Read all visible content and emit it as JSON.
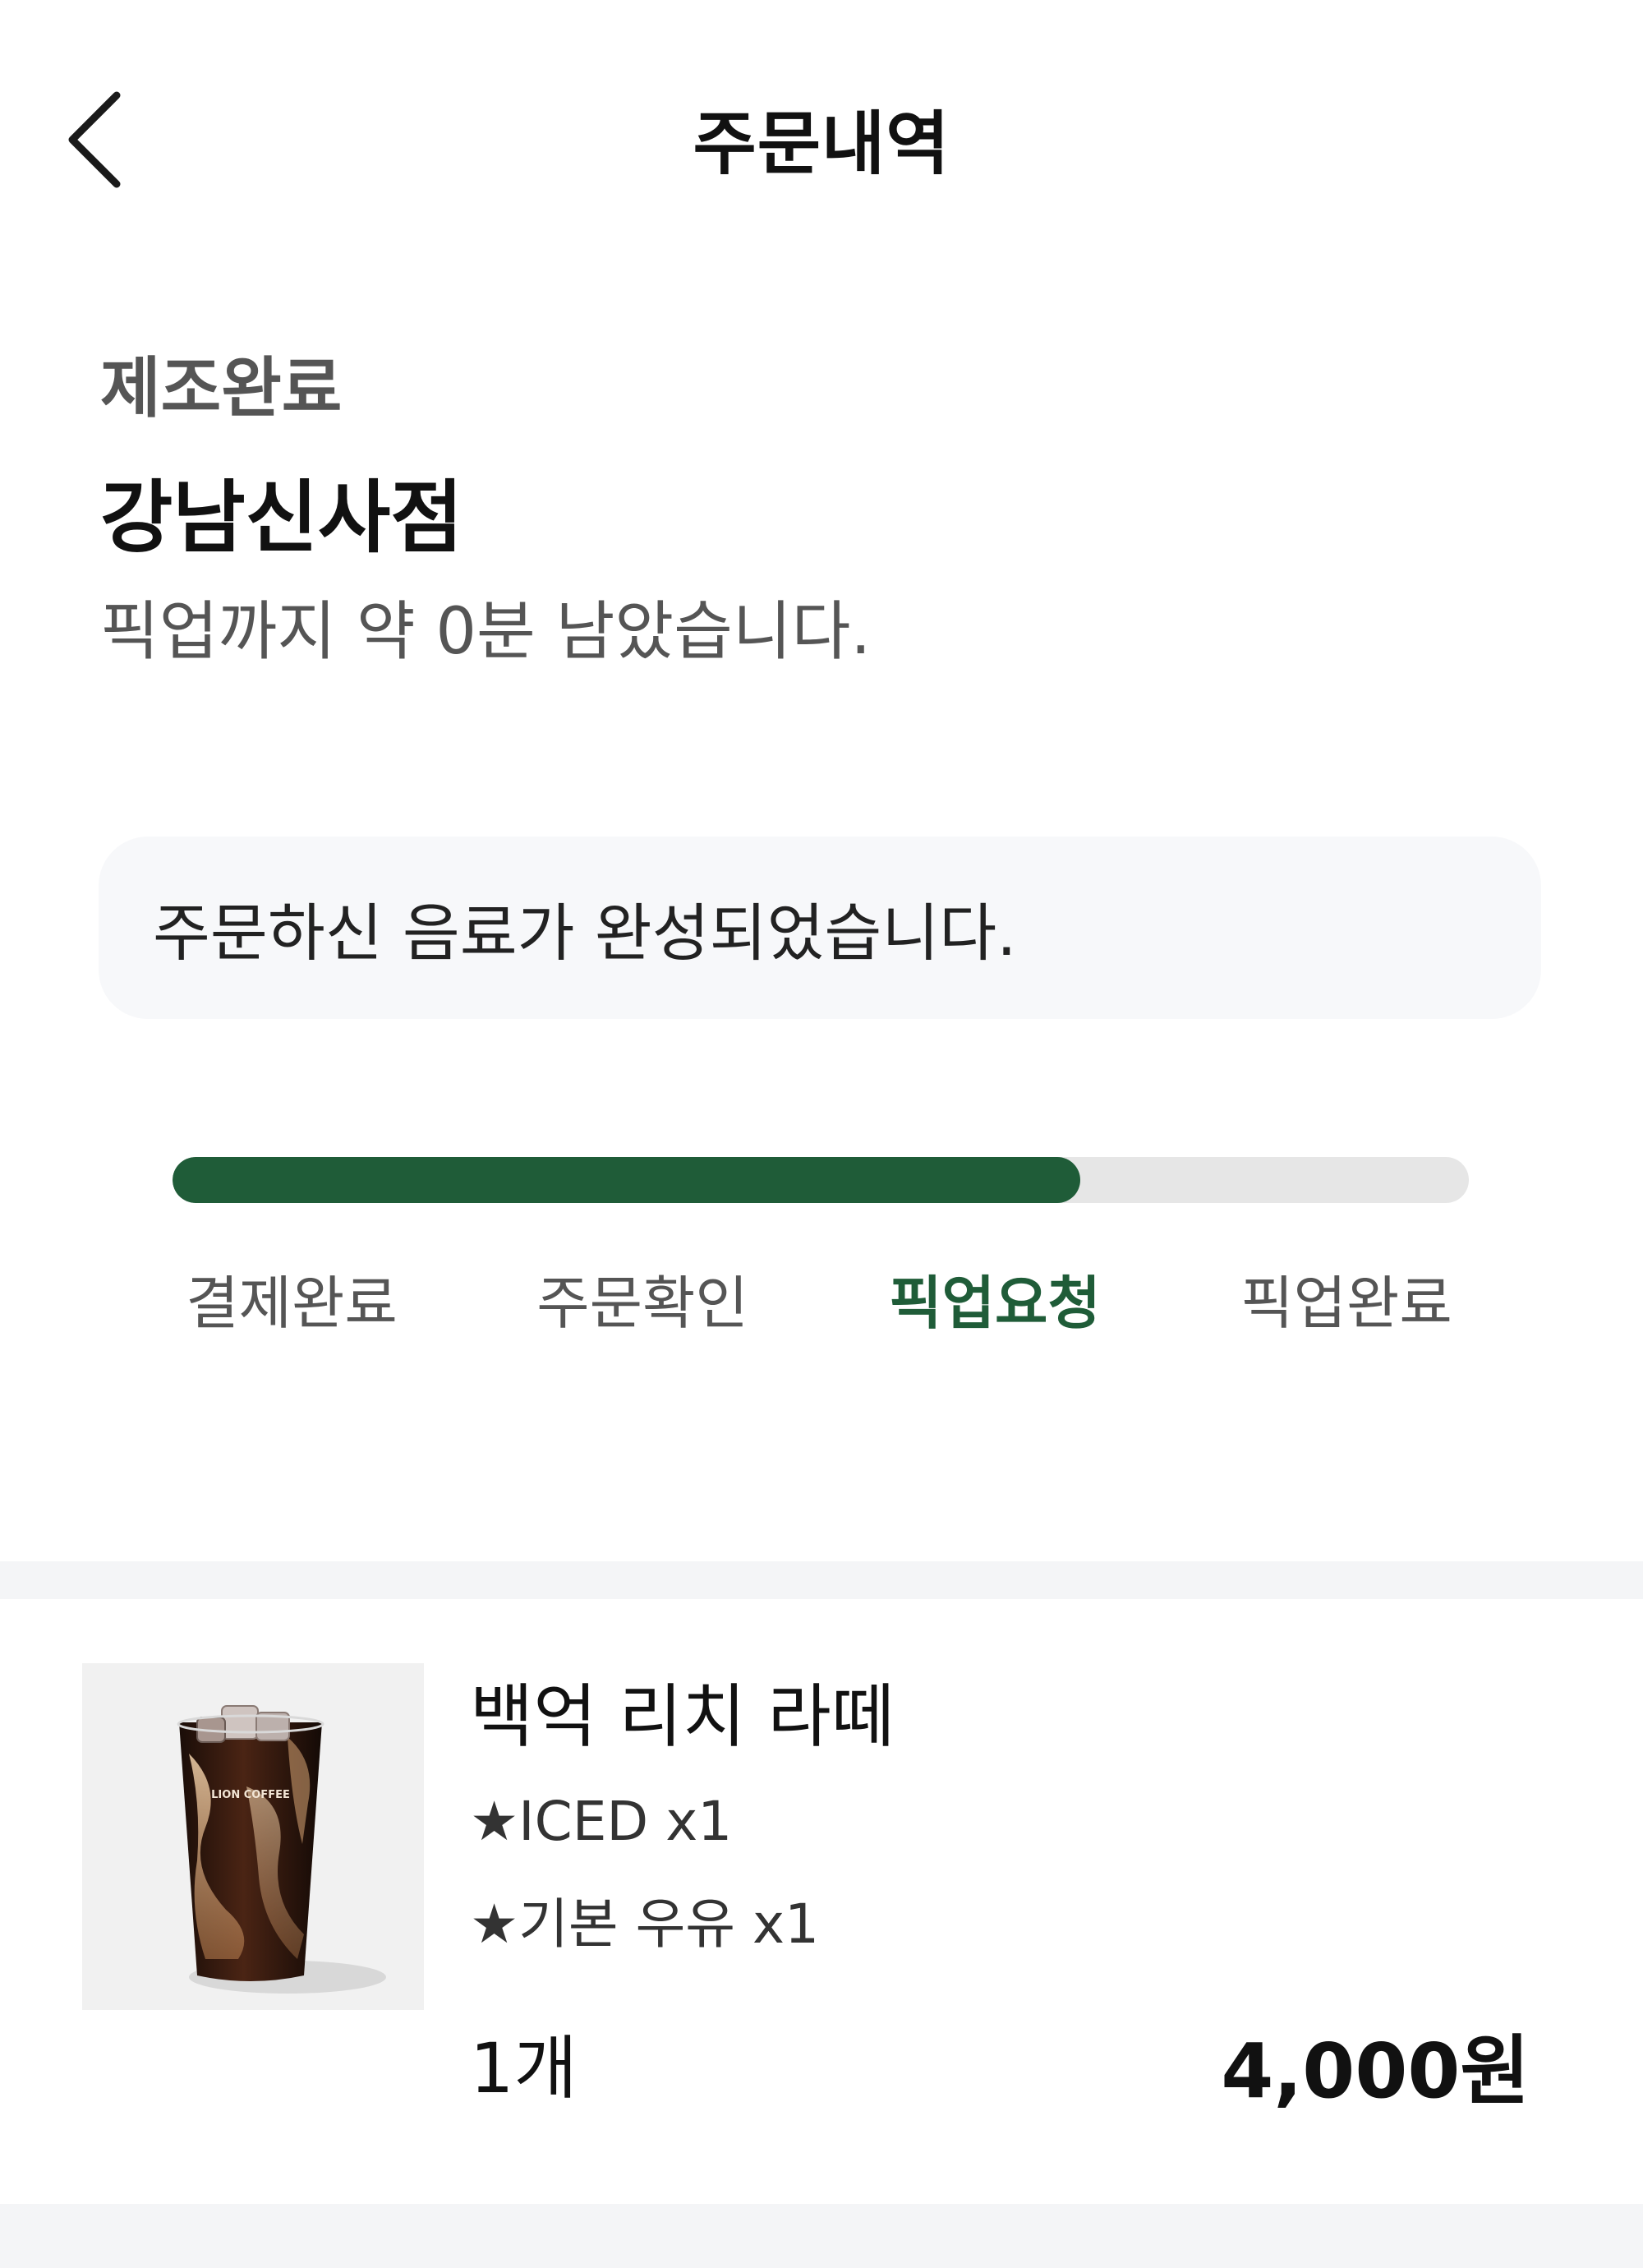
{
  "header": {
    "title": "주문내역",
    "back_icon": "chevron-left-icon"
  },
  "order": {
    "status": "제조완료",
    "store": "강남신사점",
    "pickup_eta": "픽업까지 약 0분 남았습니다."
  },
  "notice": {
    "message": "주문하신 음료가 완성되었습니다."
  },
  "progress": {
    "fraction": 0.7,
    "fill_color": "#1f5c38",
    "track_color": "#e6e6e6",
    "steps": [
      {
        "label": "결제완료"
      },
      {
        "label": "주문확인"
      },
      {
        "label": "픽업요청"
      },
      {
        "label": "픽업완료"
      }
    ],
    "active_step": 2
  },
  "item": {
    "name": "백억 리치 라떼",
    "options": [
      "★ICED x1",
      "★기본 우유 x1"
    ],
    "quantity": "1개",
    "price": "4,000원",
    "image_icon": "iced-latte-cup-image",
    "cup_text": "LION COFFEE"
  }
}
